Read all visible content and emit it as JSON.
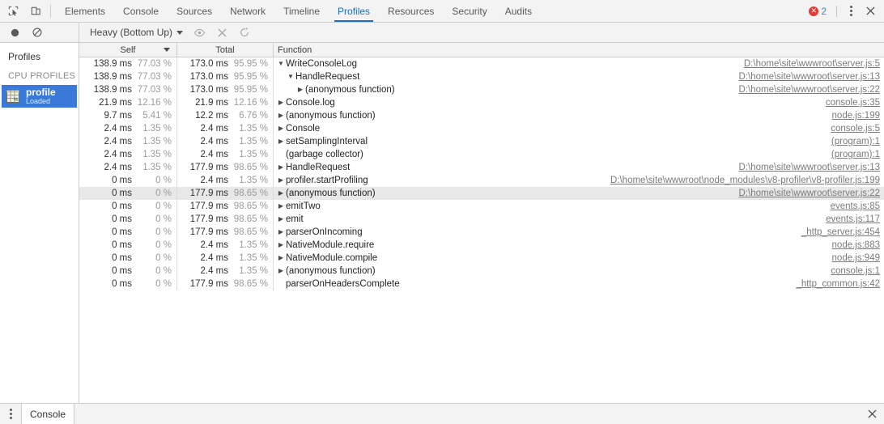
{
  "top_toolbar": {
    "inspect_icon": "inspect-cursor-icon",
    "device_icon": "device-toolbar-icon",
    "tabs": [
      {
        "label": "Elements",
        "active": false
      },
      {
        "label": "Console",
        "active": false
      },
      {
        "label": "Sources",
        "active": false
      },
      {
        "label": "Network",
        "active": false
      },
      {
        "label": "Timeline",
        "active": false
      },
      {
        "label": "Profiles",
        "active": true
      },
      {
        "label": "Resources",
        "active": false
      },
      {
        "label": "Security",
        "active": false
      },
      {
        "label": "Audits",
        "active": false
      }
    ],
    "error_count": "2",
    "error_glyph": "✕",
    "more_icon": "kebab-menu-icon",
    "close_icon": "close-icon",
    "accent_color": "#1b6bc4",
    "error_color": "#e53935"
  },
  "profile_toolbar": {
    "record_label": "record-button",
    "clear_label": "clear-button",
    "view_mode": "Heavy (Bottom Up)",
    "focus_icon": "eye-icon",
    "exclude_icon": "x-icon",
    "restore_icon": "refresh-icon"
  },
  "sidebar": {
    "title": "Profiles",
    "section": "CPU PROFILES",
    "items": [
      {
        "name": "profile",
        "status": "Loaded",
        "icon": "profile-grid-icon",
        "selected": true
      }
    ],
    "selected_color": "#3b79d9"
  },
  "table": {
    "columns": [
      {
        "key": "self",
        "label": "Self",
        "sorted": true,
        "sort_dir": "desc"
      },
      {
        "key": "total",
        "label": "Total",
        "sorted": false
      },
      {
        "key": "function",
        "label": "Function",
        "sorted": false
      }
    ],
    "rows": [
      {
        "self_ms": "138.9 ms",
        "self_pct": "77.03 %",
        "total_ms": "173.0 ms",
        "total_pct": "95.95 %",
        "tri": "▼",
        "depth": 0,
        "name": "WriteConsoleLog",
        "url": "D:\\home\\site\\wwwroot\\server.js:5",
        "selected": false
      },
      {
        "self_ms": "138.9 ms",
        "self_pct": "77.03 %",
        "total_ms": "173.0 ms",
        "total_pct": "95.95 %",
        "tri": "▼",
        "depth": 1,
        "name": "HandleRequest",
        "url": "D:\\home\\site\\wwwroot\\server.js:13",
        "selected": false
      },
      {
        "self_ms": "138.9 ms",
        "self_pct": "77.03 %",
        "total_ms": "173.0 ms",
        "total_pct": "95.95 %",
        "tri": "▶",
        "depth": 2,
        "name": "(anonymous function)",
        "url": "D:\\home\\site\\wwwroot\\server.js:22",
        "selected": false
      },
      {
        "self_ms": "21.9 ms",
        "self_pct": "12.16 %",
        "total_ms": "21.9 ms",
        "total_pct": "12.16 %",
        "tri": "▶",
        "depth": 0,
        "name": "Console.log",
        "url": "console.js:35",
        "selected": false
      },
      {
        "self_ms": "9.7 ms",
        "self_pct": "5.41 %",
        "total_ms": "12.2 ms",
        "total_pct": "6.76 %",
        "tri": "▶",
        "depth": 0,
        "name": "(anonymous function)",
        "url": "node.js:199",
        "selected": false
      },
      {
        "self_ms": "2.4 ms",
        "self_pct": "1.35 %",
        "total_ms": "2.4 ms",
        "total_pct": "1.35 %",
        "tri": "▶",
        "depth": 0,
        "name": "Console",
        "url": "console.js:5",
        "selected": false
      },
      {
        "self_ms": "2.4 ms",
        "self_pct": "1.35 %",
        "total_ms": "2.4 ms",
        "total_pct": "1.35 %",
        "tri": "▶",
        "depth": 0,
        "name": "setSamplingInterval",
        "url": "(program):1",
        "selected": false
      },
      {
        "self_ms": "2.4 ms",
        "self_pct": "1.35 %",
        "total_ms": "2.4 ms",
        "total_pct": "1.35 %",
        "tri": "",
        "depth": 0,
        "name": "(garbage collector)",
        "url": "(program):1",
        "selected": false
      },
      {
        "self_ms": "2.4 ms",
        "self_pct": "1.35 %",
        "total_ms": "177.9 ms",
        "total_pct": "98.65 %",
        "tri": "▶",
        "depth": 0,
        "name": "HandleRequest",
        "url": "D:\\home\\site\\wwwroot\\server.js:13",
        "selected": false
      },
      {
        "self_ms": "0 ms",
        "self_pct": "0 %",
        "total_ms": "2.4 ms",
        "total_pct": "1.35 %",
        "tri": "▶",
        "depth": 0,
        "name": "profiler.startProfiling",
        "url": "D:\\home\\site\\wwwroot\\node_modules\\v8-profiler\\v8-profiler.js:199",
        "selected": false
      },
      {
        "self_ms": "0 ms",
        "self_pct": "0 %",
        "total_ms": "177.9 ms",
        "total_pct": "98.65 %",
        "tri": "▶",
        "depth": 0,
        "name": "(anonymous function)",
        "url": "D:\\home\\site\\wwwroot\\server.js:22",
        "selected": true
      },
      {
        "self_ms": "0 ms",
        "self_pct": "0 %",
        "total_ms": "177.9 ms",
        "total_pct": "98.65 %",
        "tri": "▶",
        "depth": 0,
        "name": "emitTwo",
        "url": "events.js:85",
        "selected": false
      },
      {
        "self_ms": "0 ms",
        "self_pct": "0 %",
        "total_ms": "177.9 ms",
        "total_pct": "98.65 %",
        "tri": "▶",
        "depth": 0,
        "name": "emit",
        "url": "events.js:117",
        "selected": false
      },
      {
        "self_ms": "0 ms",
        "self_pct": "0 %",
        "total_ms": "177.9 ms",
        "total_pct": "98.65 %",
        "tri": "▶",
        "depth": 0,
        "name": "parserOnIncoming",
        "url": "_http_server.js:454",
        "selected": false
      },
      {
        "self_ms": "0 ms",
        "self_pct": "0 %",
        "total_ms": "2.4 ms",
        "total_pct": "1.35 %",
        "tri": "▶",
        "depth": 0,
        "name": "NativeModule.require",
        "url": "node.js:883",
        "selected": false
      },
      {
        "self_ms": "0 ms",
        "self_pct": "0 %",
        "total_ms": "2.4 ms",
        "total_pct": "1.35 %",
        "tri": "▶",
        "depth": 0,
        "name": "NativeModule.compile",
        "url": "node.js:949",
        "selected": false
      },
      {
        "self_ms": "0 ms",
        "self_pct": "0 %",
        "total_ms": "2.4 ms",
        "total_pct": "1.35 %",
        "tri": "▶",
        "depth": 0,
        "name": "(anonymous function)",
        "url": "console.js:1",
        "selected": false
      },
      {
        "self_ms": "0 ms",
        "self_pct": "0 %",
        "total_ms": "177.9 ms",
        "total_pct": "98.65 %",
        "tri": "",
        "depth": 0,
        "name": "parserOnHeadersComplete",
        "url": "_http_common.js:42",
        "selected": false
      }
    ]
  },
  "drawer": {
    "menu_icon": "kebab-menu-icon",
    "tabs": [
      {
        "label": "Console",
        "active": true
      }
    ],
    "close_icon": "close-icon"
  }
}
